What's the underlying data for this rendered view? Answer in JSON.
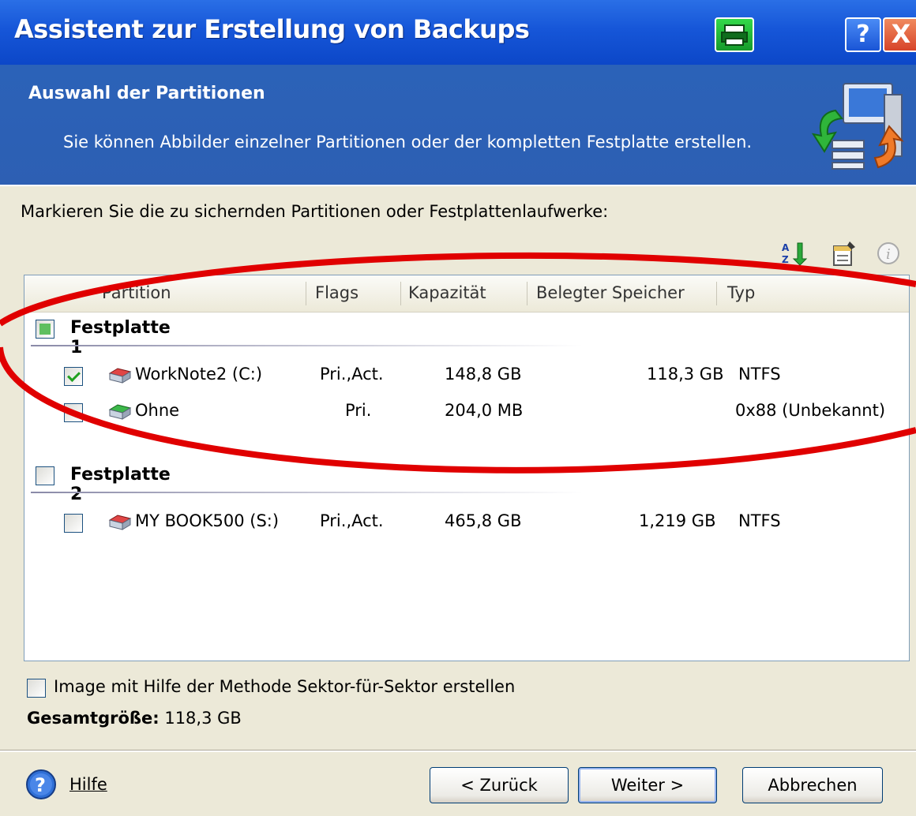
{
  "window": {
    "title": "Assistent zur Erstellung von Backups",
    "help_glyph": "?",
    "close_glyph": "X"
  },
  "header": {
    "title": "Auswahl der Partitionen",
    "subtitle": "Sie können Abbilder einzelner Partitionen oder der kompletten Festplatte erstellen."
  },
  "instruction": "Markieren Sie die zu sichernden Partitionen oder Festplattenlaufwerke:",
  "toolbar_icons": [
    "sort-az-icon",
    "properties-icon",
    "info-icon"
  ],
  "columns": [
    "Partition",
    "Flags",
    "Kapazität",
    "Belegter Speicher",
    "Typ"
  ],
  "disks": [
    {
      "name": "Festplatte 1",
      "state": "partial",
      "partitions": [
        {
          "checked": true,
          "name": "WorkNote2 (C:)",
          "flags": "Pri.,Act.",
          "capacity": "148,8 GB",
          "used": "118,3 GB",
          "type": "NTFS"
        },
        {
          "checked": false,
          "name": "Ohne",
          "flags": "Pri.",
          "capacity": "204,0 MB",
          "used": "",
          "type": "0x88 (Unbekannt)"
        }
      ]
    },
    {
      "name": "Festplatte 2",
      "state": "unchecked",
      "partitions": [
        {
          "checked": false,
          "name": "MY BOOK500 (S:)",
          "flags": "Pri.,Act.",
          "capacity": "465,8 GB",
          "used": "1,219 GB",
          "type": "NTFS"
        }
      ]
    }
  ],
  "sector_option": "Image mit Hilfe der Methode Sektor-für-Sektor erstellen",
  "total": {
    "label": "Gesamtgröße:",
    "value": "118,3 GB"
  },
  "buttons": {
    "help": "Hilfe",
    "back": "< Zurück",
    "next": "Weiter >",
    "cancel": "Abbrechen"
  },
  "colors": {
    "title_bar": "#1656d8",
    "header_bg": "#2b62b8",
    "annotation": "#e00000"
  }
}
